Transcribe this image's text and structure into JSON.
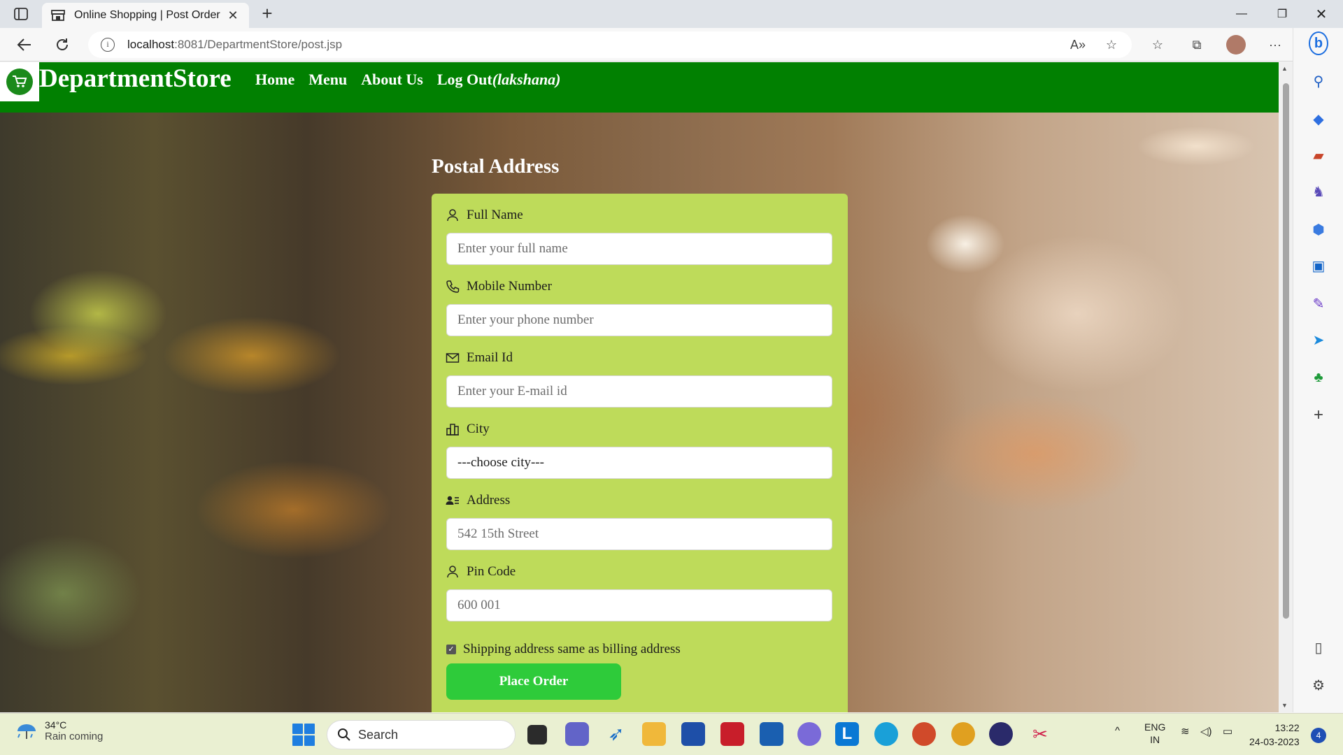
{
  "browser": {
    "tab_title": "Online Shopping | Post Order",
    "tab_close": "✕",
    "new_tab": "+",
    "url_host": "localhost",
    "url_rest": ":8081/DepartmentStore/post.jsp",
    "window_min": "—",
    "window_max": "❐",
    "window_close": "✕"
  },
  "site": {
    "brand": "DepartmentStore",
    "nav": [
      {
        "label": "Home"
      },
      {
        "label": "Menu"
      },
      {
        "label": "About Us"
      },
      {
        "label": "Log Out",
        "user": "(lakshana)"
      }
    ]
  },
  "form": {
    "title": "Postal Address",
    "fields": [
      {
        "label": "Full Name",
        "placeholder": "Enter your full name",
        "value": ""
      },
      {
        "label": "Mobile Number",
        "placeholder": "Enter your phone number",
        "value": ""
      },
      {
        "label": "Email Id",
        "placeholder": "Enter your E-mail id",
        "value": ""
      },
      {
        "label": "City",
        "selected": "---choose city---"
      },
      {
        "label": "Address",
        "placeholder": "542 15th Street",
        "value": ""
      },
      {
        "label": "Pin Code",
        "placeholder": "600 001",
        "value": ""
      }
    ],
    "checkbox_label": "Shipping address same as billing address",
    "checkbox_checked": true,
    "submit_label": "Place Order"
  },
  "taskbar": {
    "weather_temp": "34°C",
    "weather_desc": "Rain coming",
    "search_label": "Search",
    "lang_top": "ENG",
    "lang_bottom": "IN",
    "time": "13:22",
    "date": "24-03-2023",
    "notifications": "4"
  },
  "colors": {
    "header_green": "#018001",
    "form_bg": "#bedb5a",
    "button_green": "#2ecb3a"
  }
}
